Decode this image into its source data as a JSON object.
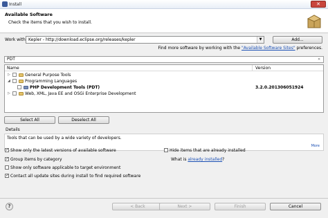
{
  "window": {
    "title": "Install"
  },
  "banner": {
    "heading": "Available Software",
    "subtitle": "Check the items that you wish to install."
  },
  "work_with": {
    "label": "Work with:",
    "value": "Kepler - http://download.eclipse.org/releases/kepler",
    "add_label": "Add...",
    "more_text": "Find more software by working with the ",
    "more_link": "\"Available Software Sites\"",
    "more_suffix": " preferences."
  },
  "filter": {
    "value": "PDT"
  },
  "table": {
    "col_name": "Name",
    "col_version": "Version",
    "rows": [
      {
        "label": "General Purpose Tools",
        "version": ""
      },
      {
        "label": "Programming Languages",
        "version": ""
      },
      {
        "label": "PHP Development Tools (PDT)",
        "version": "3.2.0.201306051924"
      },
      {
        "label": "Web, XML, Java EE and OSGi Enterprise Development",
        "version": ""
      }
    ]
  },
  "buttons": {
    "select_all": "Select All",
    "deselect_all": "Deselect All",
    "back": "< Back",
    "next": "Next >",
    "finish": "Finish",
    "cancel": "Cancel"
  },
  "details": {
    "label": "Details",
    "text": "Tools that can be used by a wide variety of developers.",
    "more": "More"
  },
  "options": {
    "show_latest": "Show only the latest versions of available software",
    "hide_installed": "Hide items that are already installed",
    "group_by_category": "Group items by category",
    "what_is": "What is ",
    "already_installed_link": "already installed",
    "what_is_suffix": "?",
    "show_applicable": "Show only software applicable to target environment",
    "contact_sites": "Contact all update sites during install to find required software"
  },
  "colors": {
    "link": "#1a4fb4",
    "close_button": "#c9463d"
  }
}
